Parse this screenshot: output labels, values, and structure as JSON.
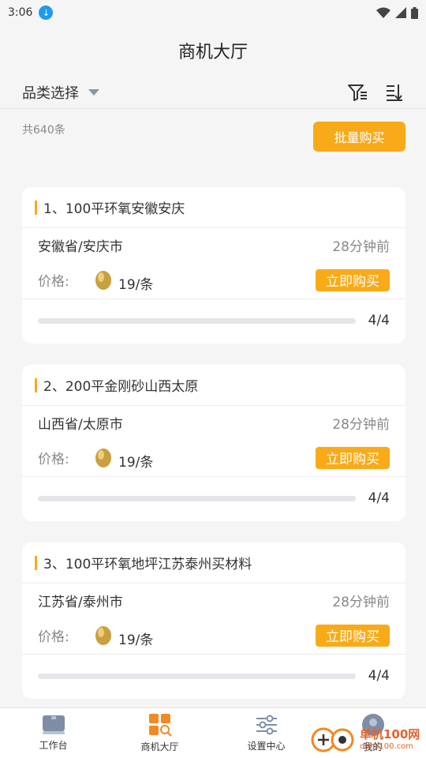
{
  "status": {
    "time": "3:06"
  },
  "header": {
    "title": "商机大厅"
  },
  "filter": {
    "category_label": "品类选择"
  },
  "summary": {
    "total_text": "共640条",
    "bulk_buy_label": "批量购买"
  },
  "cards": [
    {
      "title": "1、100平环氧安徽安庆",
      "location": "安徽省/安庆市",
      "time": "28分钟前",
      "price_label": "价格:",
      "price": "19/条",
      "buy_label": "立即购买",
      "progress_text": "4/4",
      "progress_fraction": 1.0
    },
    {
      "title": "2、200平金刚砂山西太原",
      "location": "山西省/太原市",
      "time": "28分钟前",
      "price_label": "价格:",
      "price": "19/条",
      "buy_label": "立即购买",
      "progress_text": "4/4",
      "progress_fraction": 1.0
    },
    {
      "title": "3、100平环氧地坪江苏泰州买材料",
      "location": "江苏省/泰州市",
      "time": "28分钟前",
      "price_label": "价格:",
      "price": "19/条",
      "buy_label": "立即购买",
      "progress_text": "4/4",
      "progress_fraction": 1.0
    }
  ],
  "tabs": [
    {
      "label": "工作台",
      "icon": "workbench-icon"
    },
    {
      "label": "商机大厅",
      "icon": "grid-search-icon"
    },
    {
      "label": "设置中心",
      "icon": "sliders-icon"
    },
    {
      "label": "我的",
      "icon": "avatar-icon"
    }
  ],
  "watermark": {
    "title": "单机100网",
    "url": "danji100.com"
  },
  "colors": {
    "accent": "#f9aa19",
    "active_tab": "#f08a24"
  }
}
